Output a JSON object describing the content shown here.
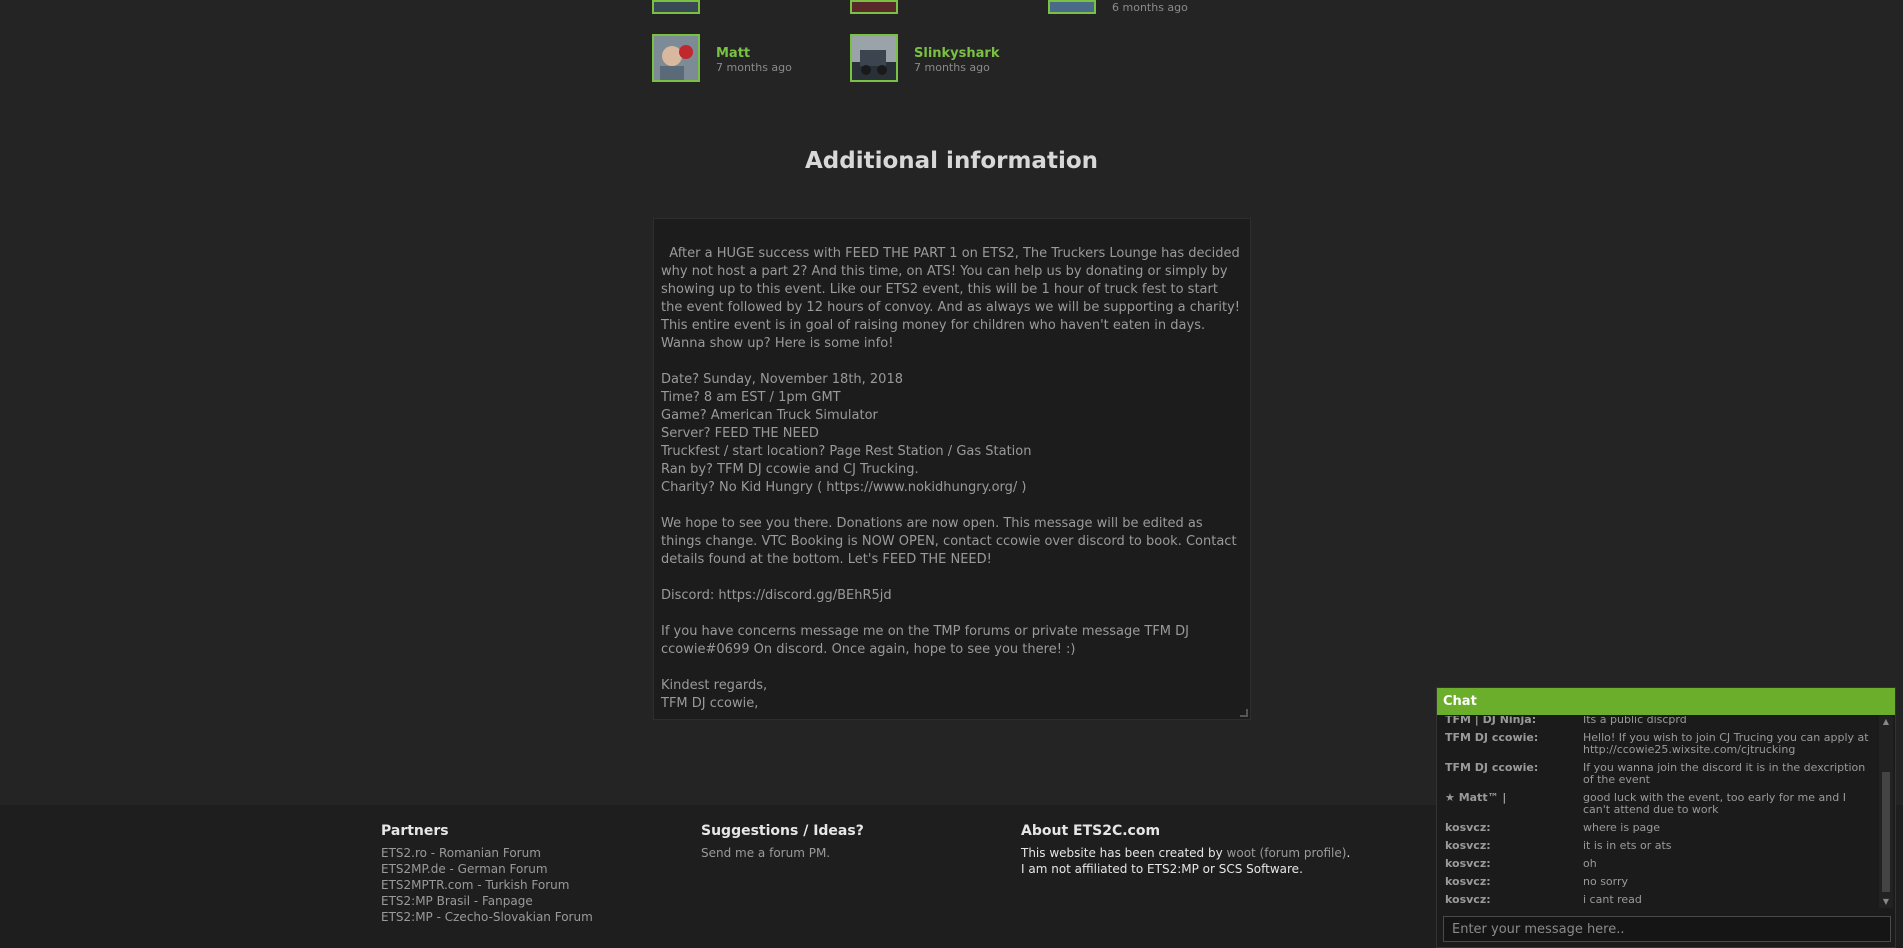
{
  "participants": [
    {
      "name": "",
      "time": ""
    },
    {
      "name": "",
      "time": ""
    },
    {
      "name": "",
      "time": "6 months ago"
    },
    {
      "name": "Matt",
      "time": "7 months ago"
    },
    {
      "name": "Slinkyshark",
      "time": "7 months ago"
    }
  ],
  "additional_info": {
    "title": "Additional information",
    "body": "After a HUGE success with FEED THE PART 1 on ETS2, The Truckers Lounge has decided why not host a part 2? And this time, on ATS! You can help us by donating or simply by showing up to this event. Like our ETS2 event, this will be 1 hour of truck fest to start the event followed by 12 hours of convoy. And as always we will be supporting a charity! This entire event is in goal of raising money for children who haven't eaten in days. Wanna show up? Here is some info!\n\nDate? Sunday, November 18th, 2018\nTime? 8 am EST / 1pm GMT\nGame? American Truck Simulator\nServer? FEED THE NEED\nTruckfest / start location? Page Rest Station / Gas Station\nRan by? TFM DJ ccowie and CJ Trucking.\nCharity? No Kid Hungry ( https://www.nokidhungry.org/ )\n\nWe hope to see you there. Donations are now open. This message will be edited as things change. VTC Booking is NOW OPEN, contact ccowie over discord to book. Contact details found at the bottom. Let's FEED THE NEED!\n\nDiscord: https://discord.gg/BEhR5jd\n\nIf you have concerns message me on the TMP forums or private message TFM DJ ccowie#0699 On discord. Once again, hope to see you there! :)\n\nKindest regards,\nTFM DJ ccowie,"
  },
  "footer": {
    "partners": {
      "heading": "Partners",
      "links": [
        "ETS2.ro - Romanian Forum",
        "ETS2MP.de - German Forum",
        "ETS2MPTR.com - Turkish Forum",
        "ETS2:MP Brasil - Fanpage",
        "ETS2:MP - Czecho-Slovakian Forum"
      ]
    },
    "suggestions": {
      "heading": "Suggestions / Ideas?",
      "link": "Send me a forum PM."
    },
    "about": {
      "heading": "About ETS2C.com",
      "line1_prefix": "This website has been created by ",
      "line1_link": "woot (forum profile)",
      "line1_suffix": ".",
      "line2": "I am not affiliated to ETS2:MP or SCS Software."
    }
  },
  "chat": {
    "title": "Chat",
    "messages": [
      {
        "user": "TFM | DJ Ninja:",
        "text": "Its a public discprd"
      },
      {
        "user": "TFM DJ ccowie:",
        "text": "Hello! If you wish to join CJ Trucing you can apply at http://ccowie25.wixsite.com/cjtrucking"
      },
      {
        "user": "TFM DJ ccowie:",
        "text": "If you wanna join the discord it is in the dexcription of the event"
      },
      {
        "user": "★ Matt™ |",
        "text": "good luck with the event, too early for me and I can't attend due to work"
      },
      {
        "user": "kosvcz:",
        "text": "where is page"
      },
      {
        "user": "kosvcz:",
        "text": "it is in ets or ats"
      },
      {
        "user": "kosvcz:",
        "text": "oh"
      },
      {
        "user": "kosvcz:",
        "text": "no sorry"
      },
      {
        "user": "kosvcz:",
        "text": "i cant read"
      }
    ],
    "input_placeholder": "Enter your message here.."
  },
  "colors": {
    "accent": "#7ac143",
    "chat_header": "#6aae2b",
    "background": "#242424",
    "footer": "#1e1e1e"
  }
}
